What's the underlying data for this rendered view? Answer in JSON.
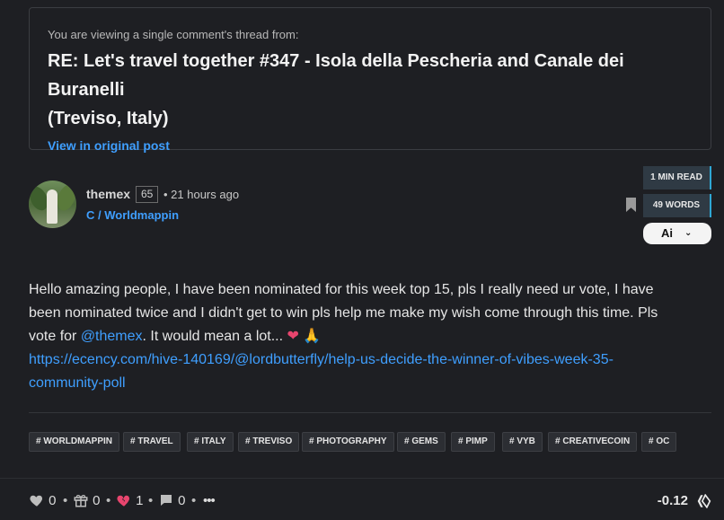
{
  "banner": {
    "pre_text": "You are viewing a single comment's thread from:",
    "title_line1": "RE: Let's travel together #347 - Isola della Pescheria and Canale dei Buranelli",
    "title_line2": "(Treviso, Italy)",
    "link_label": "View in original post"
  },
  "author": {
    "username": "themex",
    "reputation": "65",
    "time_ago": "• 21 hours ago",
    "community": "C / Worldmappin"
  },
  "meta": {
    "read_time": "1 MIN READ",
    "word_count": "49 WORDS",
    "ai_label": "Ai",
    "ai_chevron": "⌄"
  },
  "body": {
    "line1": "Hello amazing people, I have been nominated for this week top 15, pls I really need ur vote, I have",
    "line2": "been nominated twice and I didn't get to win pls help me make my wish come through this time. Pls",
    "line3_prefix": "vote for ",
    "mention": "@themex",
    "line3_suffix": ". It would mean a lot... ",
    "emoji_heart": "❤",
    "emoji_hands": "🙏",
    "url_line1": "https://ecency.com/hive-140169/@lordbutterfly/help-us-decide-the-winner-of-vibes-week-35-",
    "url_line2": "community-poll"
  },
  "tags": [
    "# WORLDMAPPIN",
    "# TRAVEL",
    "# ITALY",
    "# TREVISO",
    "# PHOTOGRAPHY",
    "# GEMS",
    "# PIMP",
    "# VYB",
    "# CREATIVECOIN",
    "# OC"
  ],
  "actions": {
    "likes": "0",
    "gifts": "0",
    "downvotes": "1",
    "comments": "0",
    "dot": "•",
    "more": "•••",
    "payout": "-0.12"
  },
  "colors": {
    "background": "#1e1f23",
    "link": "#3f9fff",
    "badge_bg": "#2f3a44",
    "badge_accent": "#2fa7d4",
    "downvote": "#e8456e"
  }
}
